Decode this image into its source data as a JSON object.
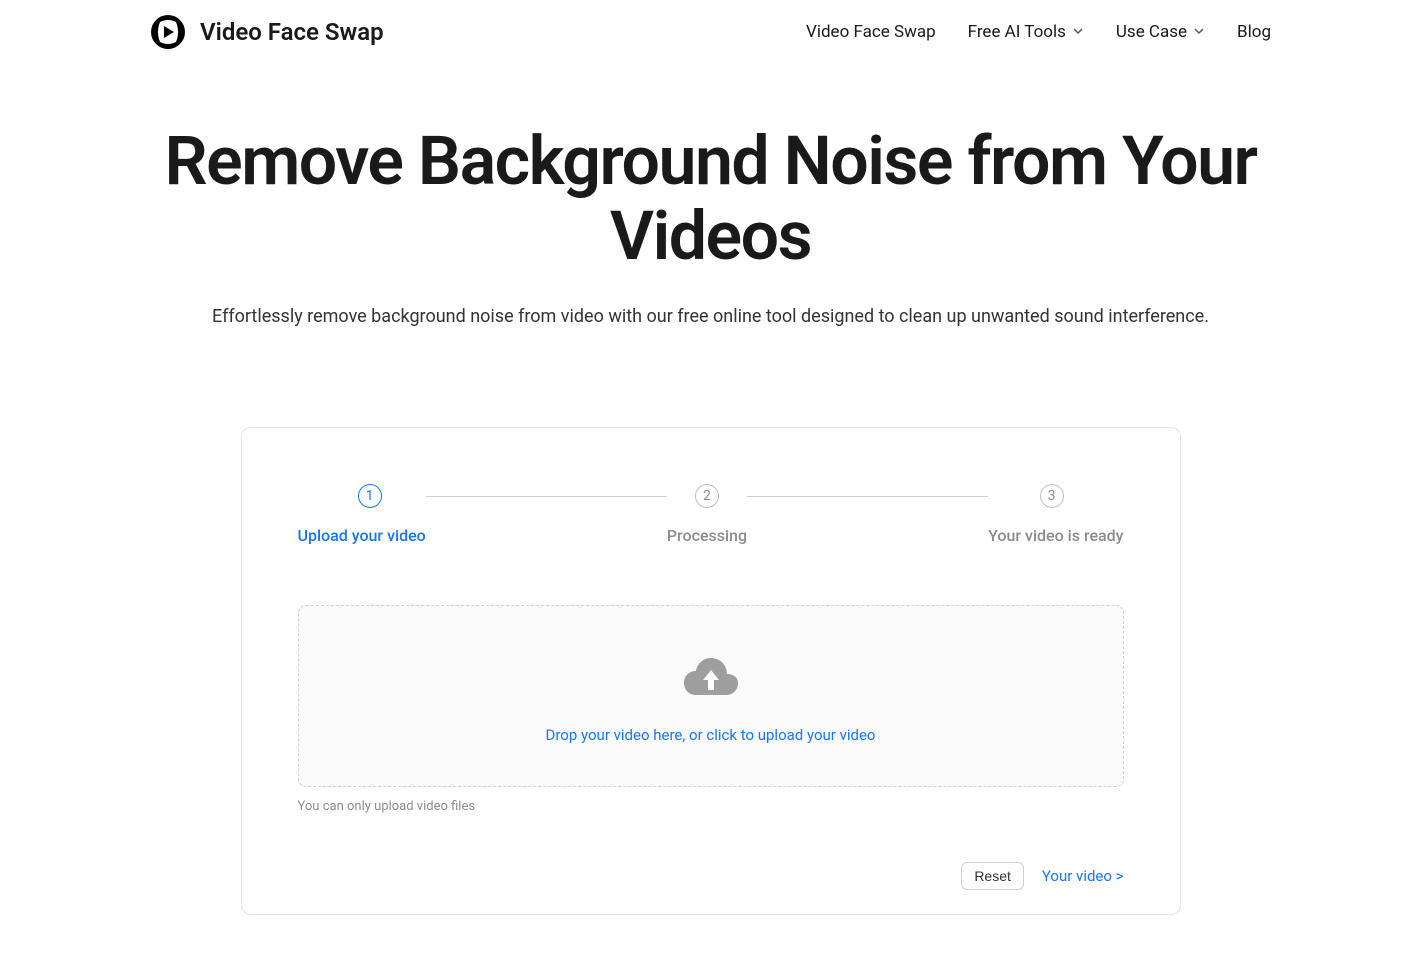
{
  "brand": {
    "name": "Video Face Swap"
  },
  "nav": {
    "items": [
      {
        "label": "Video Face Swap",
        "dropdown": false
      },
      {
        "label": "Free AI Tools",
        "dropdown": true
      },
      {
        "label": "Use Case",
        "dropdown": true
      },
      {
        "label": "Blog",
        "dropdown": false
      }
    ]
  },
  "hero": {
    "title": "Remove Background Noise from Your Videos",
    "subtitle": "Effortlessly remove background noise from video with our free online tool designed to clean up unwanted sound interference."
  },
  "steps": [
    {
      "num": "1",
      "label": "Upload your video",
      "active": true
    },
    {
      "num": "2",
      "label": "Processing",
      "active": false
    },
    {
      "num": "3",
      "label": "Your video is ready",
      "active": false
    }
  ],
  "upload": {
    "text": "Drop your video here, or click to upload your video",
    "hint": "You can only upload video files"
  },
  "footer": {
    "reset": "Reset",
    "next": "Your video >"
  }
}
